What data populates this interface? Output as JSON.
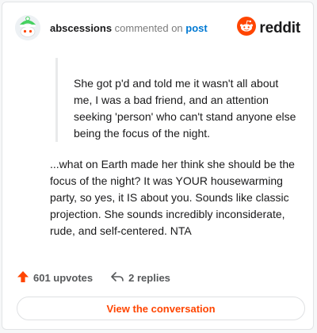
{
  "header": {
    "username": "abscessions",
    "action": "commented on",
    "target": "post",
    "brand": "reddit"
  },
  "comment": {
    "quote": "She got p'd and told me it wasn't all about me, I was a bad friend, and an attention seeking 'person' who can't stand anyone else being the focus of the night.",
    "body": "...what on Earth made her think she should be the focus of the night? It was YOUR housewarming party, so yes, it IS about you. Sounds like classic projection. She sounds incredibly inconsiderate, rude, and self-centered. NTA"
  },
  "footer": {
    "upvotes": "601 upvotes",
    "replies": "2 replies"
  },
  "cta": {
    "label": "View the conversation"
  },
  "colors": {
    "accent": "#ff4500",
    "link": "#0079d3"
  },
  "icons": [
    "avatar",
    "reddit-logo-icon",
    "upvote-arrow-icon",
    "reply-icon"
  ]
}
